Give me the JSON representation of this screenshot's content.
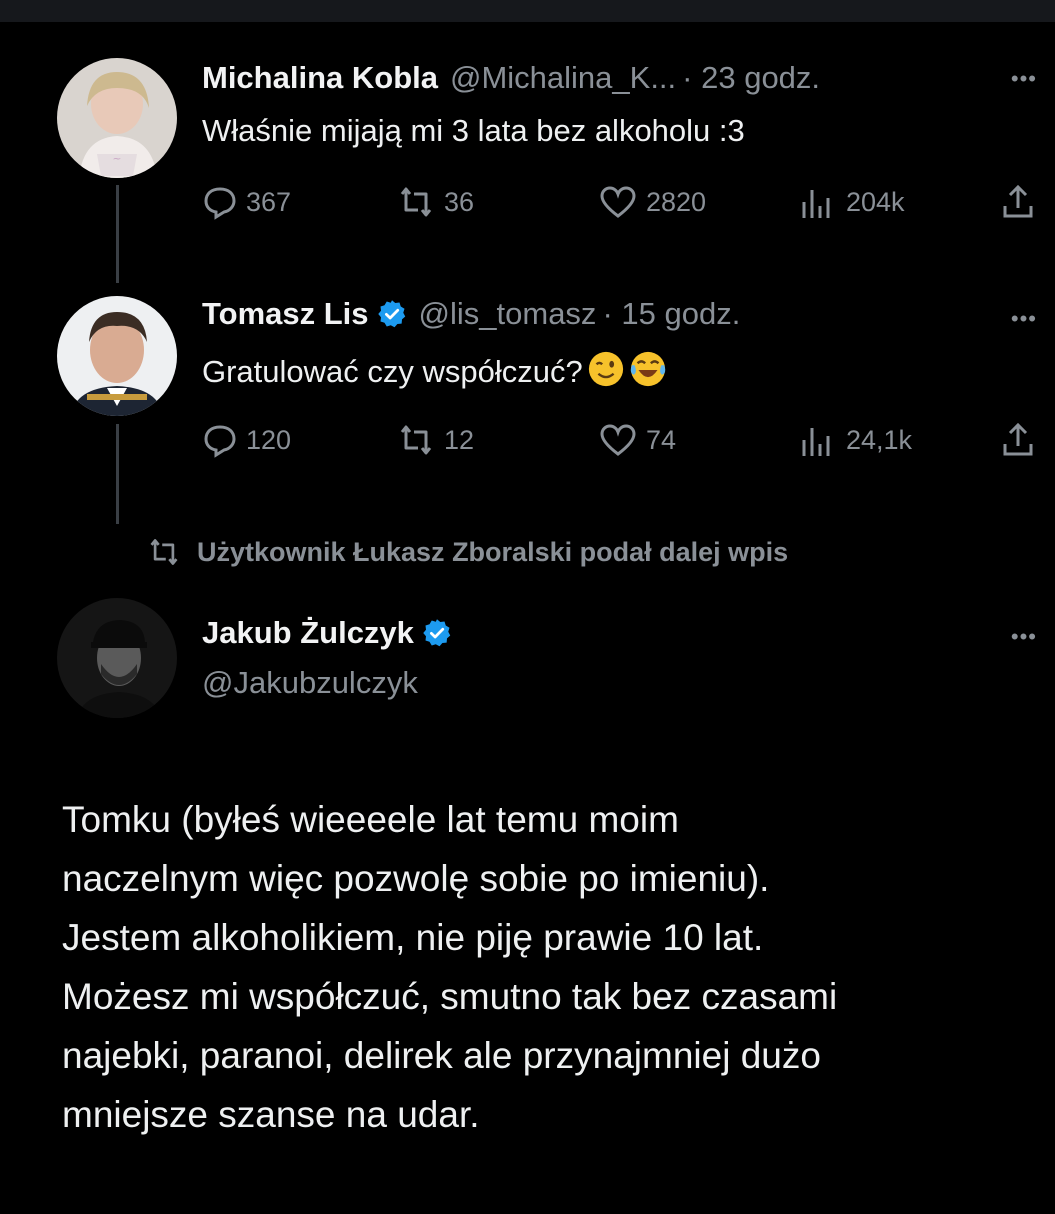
{
  "tweets": [
    {
      "name": "Michalina Kobla",
      "handle": "@Michalina_K...",
      "time": "· 23 godz.",
      "text": "Właśnie mijają mi 3 lata bez alkoholu :3",
      "replies": "367",
      "retweets": "36",
      "likes": "2820",
      "views": "204k"
    },
    {
      "name": "Tomasz Lis",
      "handle": "@lis_tomasz",
      "time": "· 15 godz.",
      "text": "Gratulować czy współczuć?",
      "emojis": [
        "winking-face",
        "tears-of-joy-face"
      ],
      "replies": "120",
      "retweets": "12",
      "likes": "74",
      "views": "24,1k"
    }
  ],
  "retweet_notice": "Użytkownik Łukasz Zboralski podał dalej wpis",
  "main_tweet": {
    "name": "Jakub Żulczyk",
    "handle": "@Jakubzulczyk",
    "lines": [
      "Tomku (byłeś wieeeele lat temu moim",
      "naczelnym więc pozwolę sobie po imieniu).",
      "Jestem alkoholikiem, nie piję prawie 10 lat.",
      "Możesz mi współczuć, smutno tak bez czasami",
      "najebki, paranoi, delirek ale przynajmniej dużo",
      "mniejsze szanse na udar."
    ]
  },
  "more_glyph": "•••",
  "colors": {
    "background": "#000000",
    "muted": "#8a9097",
    "verified": "#1d9bf0"
  },
  "icons": [
    "reply-icon",
    "retweet-icon",
    "like-icon",
    "views-icon",
    "share-icon",
    "verified-badge-icon",
    "more-icon"
  ]
}
